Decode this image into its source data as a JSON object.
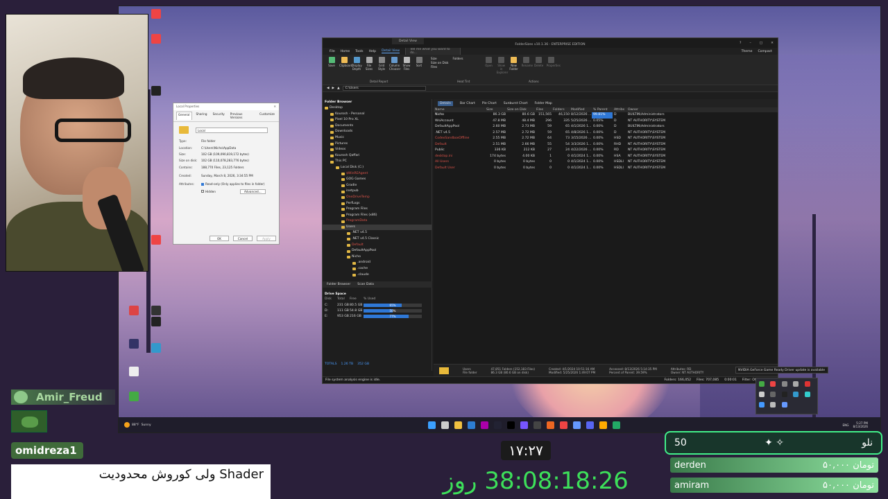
{
  "dialog": {
    "title": "Local Properties",
    "tabs": [
      "General",
      "Sharing",
      "Security",
      "Previous Versions",
      "Customize"
    ],
    "name": "Local",
    "rows": [
      {
        "k": "Type:",
        "v": "File folder"
      },
      {
        "k": "Location:",
        "v": "C:\\Users\\Nicho\\AppData"
      },
      {
        "k": "Size:",
        "v": "102 GB (109,090,819,172 bytes)"
      },
      {
        "k": "Size on disk:",
        "v": "102 GB (110,078,283,776 bytes)"
      },
      {
        "k": "Contains:",
        "v": "188,770 Files, 23,125 Folders"
      },
      {
        "k": "Created:",
        "v": "Sunday, March 8, 2026, 3:34:55 PM"
      }
    ],
    "attributes_label": "Attributes:",
    "readonly_label": "Read-only (Only applies to files in folder)",
    "hidden_label": "Hidden",
    "advanced": "Advanced...",
    "ok": "OK",
    "cancel": "Cancel",
    "apply": "Apply"
  },
  "app": {
    "title": "FolderSizes v10.1.36 - ENTERPRISE EDITION",
    "context_tab": "Detail View",
    "menu": [
      "File",
      "Home",
      "Tools",
      "Help",
      "Detail View"
    ],
    "tell_me": "Tell me what you want to do...",
    "theme": "Theme",
    "compact": "Compact",
    "ribbon": [
      "Save",
      "Clipboard",
      "Display Depth",
      "File Sizes",
      "Grid Style",
      "Column Chooser",
      "Show Files",
      "Sort"
    ],
    "ribbon_checks": [
      "Size",
      "Folders",
      "Size on Disk",
      "Files"
    ],
    "ribbon_actions": [
      "Open",
      "Show in Explorer",
      "New Folder",
      "Rename",
      "Delete",
      "Properties"
    ],
    "groups": {
      "detail": "Detail Report",
      "heat": "Heat Tint",
      "actions": "Actions"
    },
    "address": "C:\\Users",
    "folder_browser": "Folder Browser",
    "tree": [
      {
        "t": "Desktop",
        "d": 0
      },
      {
        "t": "Kourosh - Personal",
        "d": 1
      },
      {
        "t": "Pixel 10 Pro XL",
        "d": 1
      },
      {
        "t": "Documents",
        "d": 1
      },
      {
        "t": "Downloads",
        "d": 1
      },
      {
        "t": "Music",
        "d": 1
      },
      {
        "t": "Pictures",
        "d": 1
      },
      {
        "t": "Videos",
        "d": 1
      },
      {
        "t": "Kourosh Qaffari",
        "d": 1
      },
      {
        "t": "This PC",
        "d": 1
      },
      {
        "t": "Local Disk (C:)",
        "d": 2
      },
      {
        "t": "$WinREAgent",
        "d": 3,
        "red": true
      },
      {
        "t": "GOG Games",
        "d": 3
      },
      {
        "t": "Gradle",
        "d": 3
      },
      {
        "t": "inetpub",
        "d": 3
      },
      {
        "t": "OneDriveTemp",
        "d": 3,
        "red": true
      },
      {
        "t": "PerfLogs",
        "d": 3
      },
      {
        "t": "Program Files",
        "d": 3
      },
      {
        "t": "Program Files (x86)",
        "d": 3
      },
      {
        "t": "ProgramData",
        "d": 3,
        "red": true
      },
      {
        "t": "Users",
        "d": 3,
        "sel": true
      },
      {
        "t": ".NET v4.5",
        "d": 4
      },
      {
        "t": ".NET v4.5 Classic",
        "d": 4
      },
      {
        "t": "Default",
        "d": 4,
        "red": true
      },
      {
        "t": "DefaultAppPool",
        "d": 4
      },
      {
        "t": "Nicho",
        "d": 4
      },
      {
        "t": ".android",
        "d": 5
      },
      {
        "t": ".cache",
        "d": 5
      },
      {
        "t": ".claude",
        "d": 5
      }
    ],
    "left_tabs": [
      "Folder Browser",
      "Scan Data"
    ],
    "drive_space": "Drive Space",
    "drive_cols": [
      "Disk",
      "Total",
      "Free",
      "% Used"
    ],
    "drives": [
      {
        "d": "C:",
        "total": "231 GB",
        "free": "80.5 GB",
        "pct": "65%",
        "v": 0.65
      },
      {
        "d": "D:",
        "total": "111 GB",
        "free": "54.8 GB",
        "pct": "50%",
        "v": 0.5
      },
      {
        "d": "E:",
        "total": "953 GB",
        "free": "216 GB",
        "pct": "77%",
        "v": 0.77
      }
    ],
    "drive_totals": [
      "TOTALS",
      "1.26 TB",
      "352 GB"
    ],
    "right_tabs": [
      "Details",
      "Bar Chart",
      "Pie Chart",
      "Sunburst Chart",
      "Folder Map"
    ],
    "columns": [
      "Name",
      "Size",
      "Size on Disk",
      "Files",
      "Folders",
      "Modified",
      "% Parent",
      "Attribs",
      "Owner"
    ],
    "rows": [
      [
        "Nicho",
        "86.3 GB",
        "80.6 GB",
        "151,565",
        "46,150",
        "8/12/2026 ...",
        "99.81%",
        "D",
        "BUILTIN\\Administrators"
      ],
      [
        "WsiAccount",
        "47.8 MB",
        "48.4 MB",
        "296",
        "335",
        "5/25/2026 ...",
        "0.05%",
        "D",
        "NT AUTHORITY\\SYSTEM"
      ],
      [
        "DefaultAppPool",
        "2.60 MB",
        "2.73 MB",
        "59",
        "65",
        "4/1/2026 1...",
        "0.00%",
        "D",
        "BUILTIN\\Administrators"
      ],
      [
        ".NET v4.5",
        "2.57 MB",
        "2.72 MB",
        "59",
        "65",
        "4/8/2026 1...",
        "0.00%",
        "D",
        "NT AUTHORITY\\SYSTEM"
      ],
      [
        "CodexSandboxOffline",
        "2.55 MB",
        "2.72 MB",
        "64",
        "73",
        "3/15/2026 ...",
        "0.00%",
        "HSD",
        "NT AUTHORITY\\SYSTEM"
      ],
      [
        "Default",
        "2.51 MB",
        "2.66 MB",
        "55",
        "54",
        "3/3/2026 1...",
        "0.00%",
        "RHD",
        "NT AUTHORITY\\SYSTEM"
      ],
      [
        "Public",
        "336 KB",
        "212 KB",
        "27",
        "24",
        "4/22/2026 ...",
        "0.00%",
        "RD",
        "NT AUTHORITY\\SYSTEM"
      ],
      [
        "desktop.ini",
        "174 bytes",
        "4.00 KB",
        "1",
        "0",
        "4/1/2024 1...",
        "0.00%",
        "HSA",
        "NT AUTHORITY\\SYSTEM"
      ],
      [
        "All Users",
        "0 bytes",
        "0 bytes",
        "0",
        "0",
        "4/1/2024 1...",
        "0.00%",
        "HSDLI",
        "NT AUTHORITY\\SYSTEM"
      ],
      [
        "Default User",
        "0 bytes",
        "0 bytes",
        "0",
        "0",
        "4/1/2024 1...",
        "0.00%",
        "HSDLI",
        "NT AUTHORITY\\SYSTEM"
      ]
    ],
    "summary": {
      "name": "Users",
      "type": "File folder",
      "counts": "47,851 Folders (152,183 Files)",
      "size": "86.3 GB (80.6 GB on disk)",
      "created": "Created: 4/1/2024 10:51:16 AM",
      "modified": "Modified: 5/25/2026 1:49:07 PM",
      "accessed": "Accessed: 8/13/2026 5:14:35 PM",
      "parent": "Percent of Parent: 39.59%",
      "attrs": "Attributes: RD",
      "owner": "Owner: NT AUTHORITY"
    },
    "status": "File system analysis engine is idle.",
    "status_right": [
      "Folders: 166,052",
      "Files: 707,085",
      "0:00:01",
      "Filter: Off"
    ]
  },
  "toast": "NVIDIA GeForce Game Ready Driver update is available",
  "taskbar": {
    "weather_temp": "88°F",
    "weather_desc": "Sunny",
    "lang": "ENG",
    "time": "5:27 PM",
    "date": "8/13/2026"
  },
  "stream": {
    "user1": "Amir_Freud",
    "user2": "omidreza1",
    "message": "Shader  ولی کوروش محدودیت",
    "clock": "۱۷:۲۷",
    "countdown": "38:08:18:26 روز",
    "leader_name": "نلو",
    "leader_score": "50",
    "donors": [
      {
        "name": "derden",
        "amount": "۵۰,۰۰۰ تومان"
      },
      {
        "name": "amiram",
        "amount": "۵۰,۰۰۰ تومان"
      }
    ]
  },
  "colors": {
    "accent": "#2f78d6",
    "green": "#3de05a",
    "red_folder": "#e0544a"
  }
}
